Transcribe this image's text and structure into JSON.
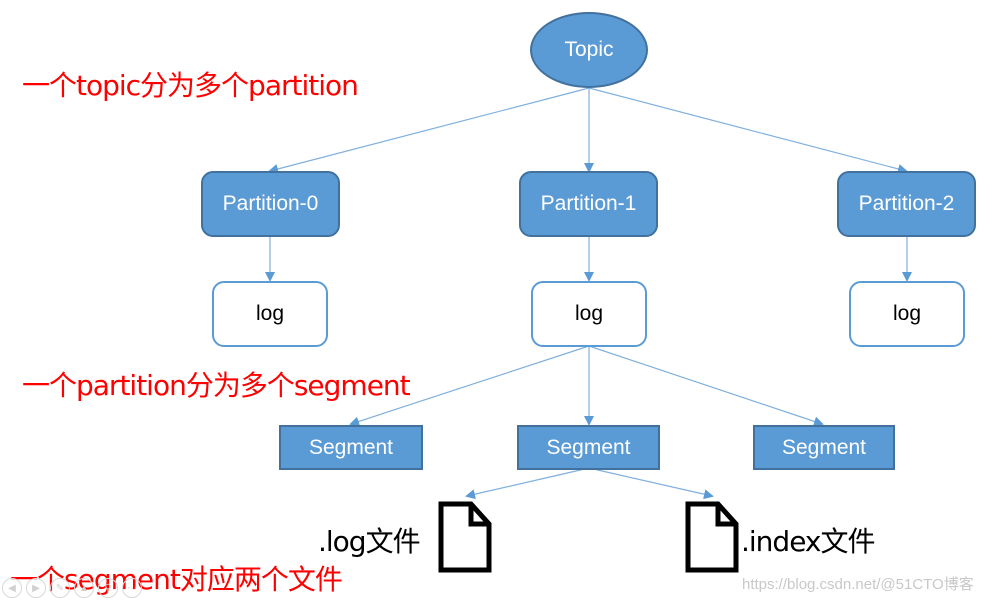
{
  "diagram": {
    "title_node": {
      "label": "Topic"
    },
    "partitions": [
      {
        "label": "Partition-0",
        "log_label": "log"
      },
      {
        "label": "Partition-1",
        "log_label": "log"
      },
      {
        "label": "Partition-2",
        "log_label": "log"
      }
    ],
    "segments": [
      {
        "label": "Segment"
      },
      {
        "label": "Segment"
      },
      {
        "label": "Segment"
      }
    ],
    "files": [
      {
        "label": ".log文件",
        "icon": "file-icon"
      },
      {
        "label": ".index文件",
        "icon": "file-icon"
      }
    ],
    "annotations": [
      "一个topic分为多个partition",
      "一个partition分为多个segment",
      "一个segment对应两个文件"
    ],
    "colors": {
      "node_fill": "#5b9bd5",
      "node_border": "#41719c",
      "edge": "#7fb0de",
      "annotation": "#ff0000"
    }
  },
  "watermark": "https://blog.csdn.net/@51CTO博客",
  "player_controls": [
    "prev-icon",
    "next-icon",
    "pen-icon",
    "pointer-icon",
    "zoom-icon",
    "more-icon"
  ]
}
